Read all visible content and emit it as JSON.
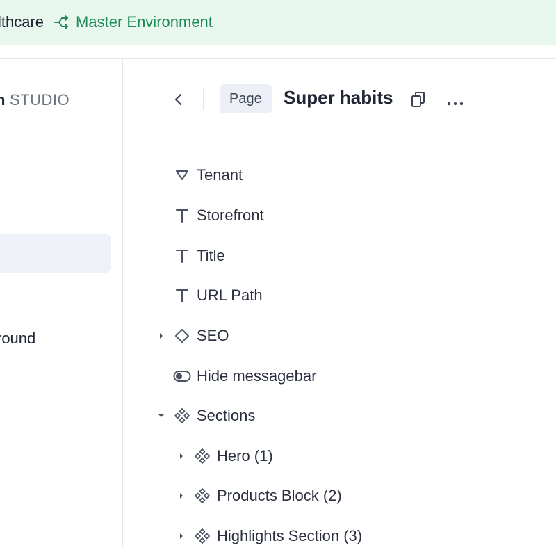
{
  "topbar": {
    "org_name": "lthcare",
    "environment": "Master Environment",
    "env_icon": "branch-icon",
    "colors": {
      "background": "#e9f8ef",
      "environment": "#1f8a57"
    }
  },
  "sidebar": {
    "logo_mark": "n",
    "logo_text": "STUDIO",
    "nav_item_label": "round"
  },
  "header": {
    "badge": "Page",
    "title": "Super habits"
  },
  "tree": {
    "items": [
      {
        "label": "Tenant",
        "icon": "reference-triangle-icon"
      },
      {
        "label": "Storefront",
        "icon": "text-type-icon"
      },
      {
        "label": "Title",
        "icon": "text-type-icon"
      },
      {
        "label": "URL Path",
        "icon": "text-type-icon"
      },
      {
        "label": "SEO",
        "icon": "diamond-icon",
        "chevron": "collapsed"
      },
      {
        "label": "Hide messagebar",
        "icon": "toggle-icon"
      },
      {
        "label": "Sections",
        "icon": "component-icon",
        "chevron": "expanded"
      },
      {
        "label": "Hero (1)",
        "icon": "component-icon",
        "chevron": "collapsed"
      },
      {
        "label": "Products Block (2)",
        "icon": "component-icon",
        "chevron": "collapsed"
      },
      {
        "label": "Highlights Section (3)",
        "icon": "component-icon",
        "chevron": "collapsed"
      }
    ]
  }
}
